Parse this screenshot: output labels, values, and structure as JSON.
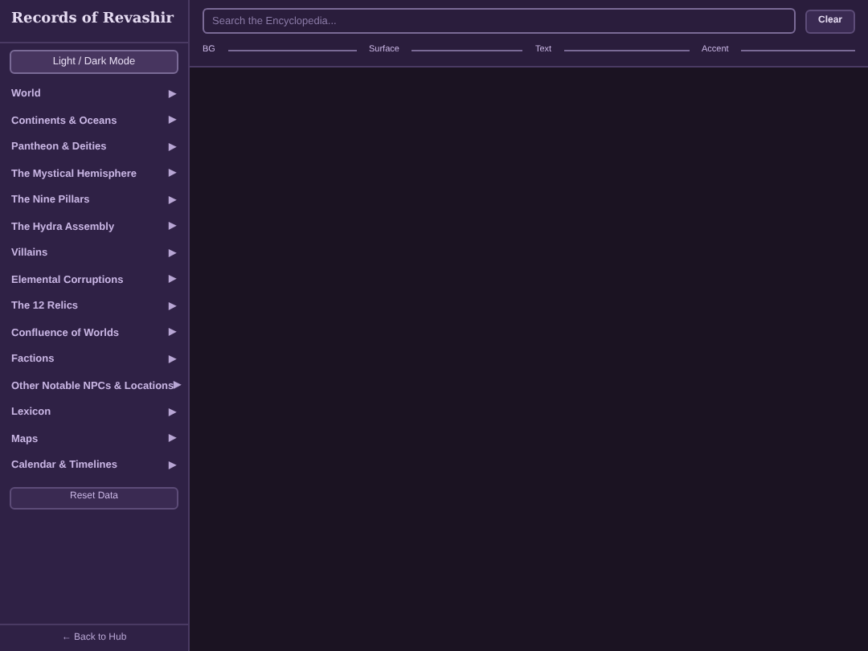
{
  "sidebar": {
    "title": "Records of Revashir",
    "mode_button": "Light / Dark Mode",
    "items": [
      {
        "label": "World",
        "arrow": "▶"
      },
      {
        "label": "Continents & Oceans",
        "arrow": "▶"
      },
      {
        "label": "Pantheon & Deities",
        "arrow": "▶"
      },
      {
        "label": "The Mystical Hemisphere",
        "arrow": "▶"
      },
      {
        "label": "The Nine Pillars",
        "arrow": "▶"
      },
      {
        "label": "The Hydra Assembly",
        "arrow": "▶"
      },
      {
        "label": "Villains",
        "arrow": "▶"
      },
      {
        "label": "Elemental Corruptions",
        "arrow": "▶"
      },
      {
        "label": "The 12 Relics",
        "arrow": "▶"
      },
      {
        "label": "Confluence of Worlds",
        "arrow": "▶"
      },
      {
        "label": "Factions",
        "arrow": "▶"
      },
      {
        "label": "Other Notable NPCs & Locations",
        "arrow": "▶"
      },
      {
        "label": "Lexicon",
        "arrow": "▶"
      },
      {
        "label": "Maps",
        "arrow": "▶"
      },
      {
        "label": "Calendar & Timelines",
        "arrow": "▶"
      }
    ],
    "reset_button": "Reset Data",
    "back_link": "← Back to Hub"
  },
  "toolbar": {
    "search": {
      "placeholder": "Search the Encyclopedia..."
    },
    "clear_button": "Clear",
    "color_controls": [
      {
        "label": "BG"
      },
      {
        "label": "Surface"
      },
      {
        "label": "Text"
      },
      {
        "label": "Accent"
      }
    ]
  }
}
